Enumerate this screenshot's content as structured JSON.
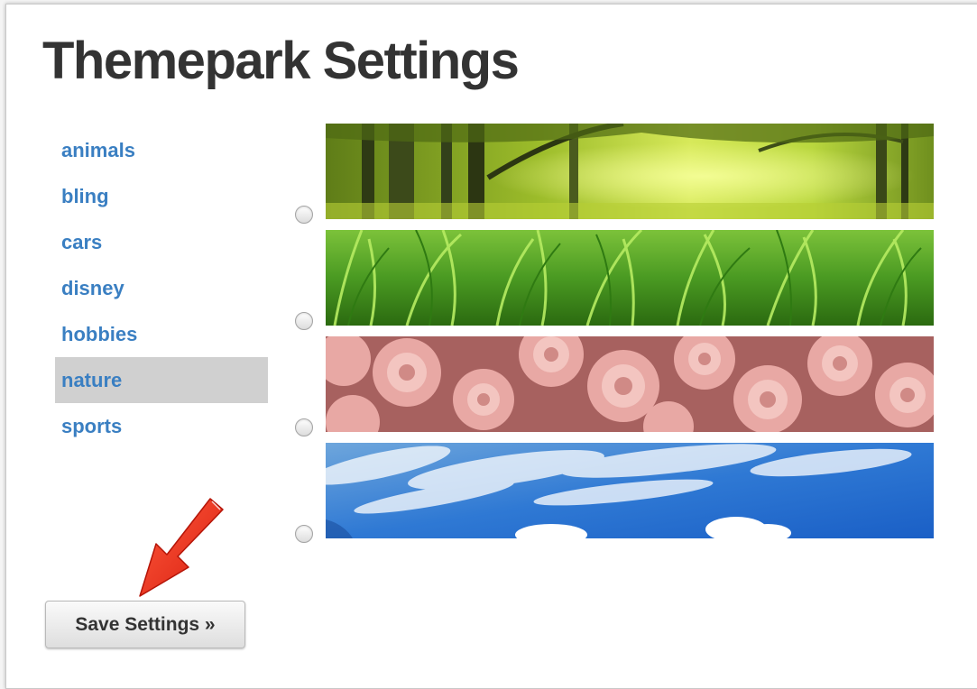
{
  "page": {
    "title": "Themepark Settings"
  },
  "categories": [
    {
      "label": "animals",
      "selected": false
    },
    {
      "label": "bling",
      "selected": false
    },
    {
      "label": "cars",
      "selected": false
    },
    {
      "label": "disney",
      "selected": false
    },
    {
      "label": "hobbies",
      "selected": false
    },
    {
      "label": "nature",
      "selected": true
    },
    {
      "label": "sports",
      "selected": false
    }
  ],
  "themes": [
    {
      "name": "forest",
      "checked": false
    },
    {
      "name": "grass",
      "checked": false
    },
    {
      "name": "roses",
      "checked": false
    },
    {
      "name": "sky",
      "checked": false
    }
  ],
  "actions": {
    "save_label": "Save Settings »"
  },
  "colors": {
    "link": "#3a7fc2",
    "selected_background": "#d0d0d0",
    "title": "#333333",
    "arrow": "#e8281c"
  },
  "icons": {
    "annotation": "red-arrow-icon"
  }
}
